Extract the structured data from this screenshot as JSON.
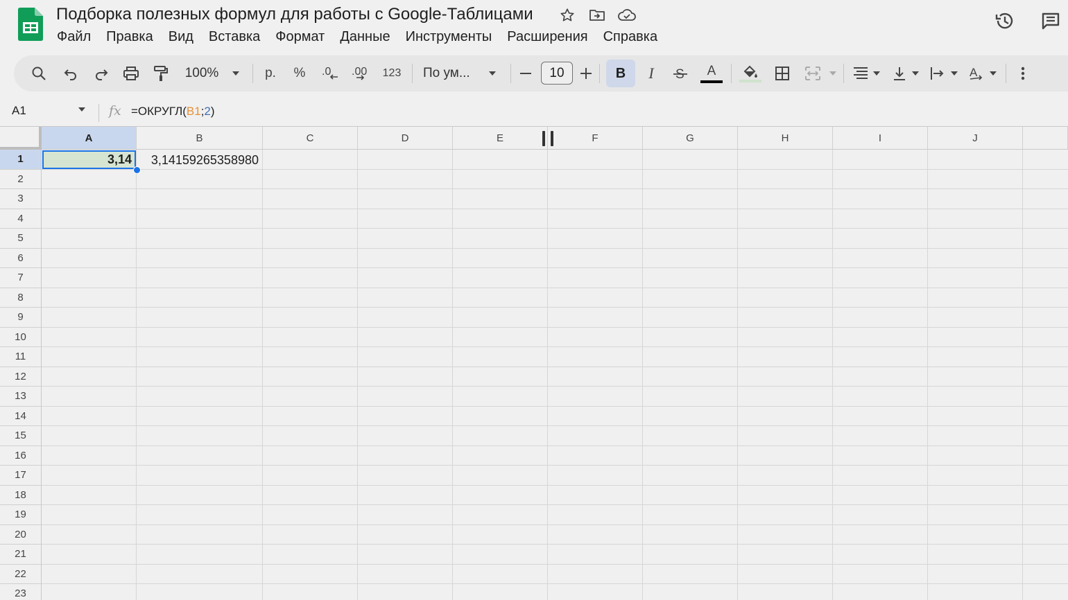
{
  "document": {
    "title": "Подборка полезных формул для работы с Google-Таблицами",
    "menu": [
      "Файл",
      "Правка",
      "Вид",
      "Вставка",
      "Формат",
      "Данные",
      "Инструменты",
      "Расширения",
      "Справка"
    ]
  },
  "toolbar": {
    "zoom": "100%",
    "currency": "р.",
    "percent": "%",
    "number_format": "123",
    "font": "По ум...",
    "font_size": "10",
    "bold_label": "B",
    "italic_label": "I",
    "text_color_label": "A"
  },
  "formula_bar": {
    "cell_ref": "A1",
    "fx": "fx",
    "formula_prefix": "=ОКРУГЛ(",
    "formula_ref": "B1",
    "formula_sep": ";",
    "formula_arg": "2",
    "formula_suffix": ")"
  },
  "grid": {
    "columns": [
      "A",
      "B",
      "C",
      "D",
      "E",
      "F",
      "G",
      "H",
      "I",
      "J"
    ],
    "rows": [
      "1",
      "2",
      "3",
      "4",
      "5",
      "6",
      "7",
      "8",
      "9",
      "10",
      "11",
      "12",
      "13",
      "14",
      "15",
      "16",
      "17",
      "18",
      "19",
      "20",
      "21",
      "22",
      "23"
    ],
    "selected_cell": "A1",
    "cells": {
      "A1": "3,14",
      "B1": "3,14159265358980"
    }
  },
  "colors": {
    "accent": "#1a73e8",
    "sheets_green": "#0f9d58",
    "selected_cell_fill": "#d6e5d2",
    "header_selected": "#c9d7ee"
  }
}
